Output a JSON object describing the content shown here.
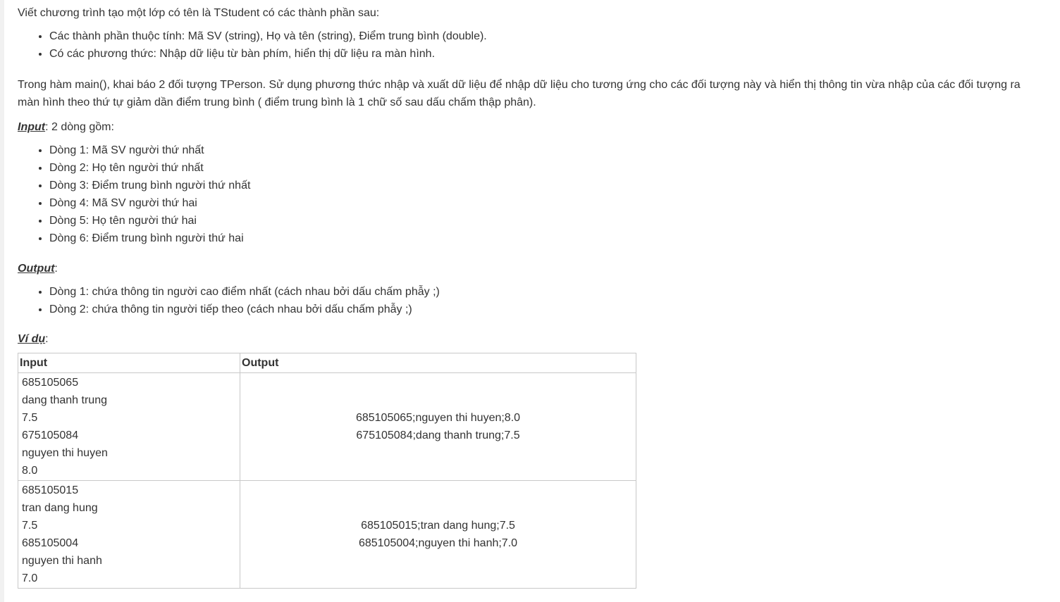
{
  "problem": {
    "intro": "Viết chương trình tạo một lớp có tên là TStudent có các thành phần sau:",
    "properties": [
      "Các thành phần thuộc tính: Mã SV (string), Họ và tên (string), Điểm trung bình (double).",
      "Có các phương thức: Nhập dữ liệu từ bàn phím, hiển thị dữ liệu ra màn hình."
    ],
    "main_paragraph": "Trong hàm main(), khai báo 2 đối tượng TPerson. Sử dụng phương thức nhập và xuất dữ liệu để nhập dữ liệu cho tương ứng cho các đối tượng này và hiển thị thông tin vừa nhập của các đối tượng ra màn hình theo thứ tự giảm dần điểm trung bình ( điểm trung bình là 1 chữ số sau dấu chấm thập phân).",
    "input_label": "Input",
    "input_suffix": ": 2 dòng gồm:",
    "input_lines": [
      "Dòng 1: Mã SV người thứ nhất",
      "Dòng 2: Họ tên người thứ nhất",
      "Dòng 3: Điểm trung bình người thứ nhất",
      "Dòng 4: Mã SV người thứ hai",
      "Dòng 5: Họ tên người thứ hai",
      "Dòng 6: Điểm trung bình người thứ hai"
    ],
    "output_label": "Output",
    "output_suffix": ":",
    "output_lines": [
      "Dòng 1: chứa thông tin người cao điểm nhất (cách nhau bởi dấu chấm phẫy ;)",
      "Dòng 2: chứa thông tin người tiếp theo (cách nhau bởi dấu chấm phẫy ;)"
    ],
    "example_label": "Ví dụ",
    "example_suffix": ":"
  },
  "table": {
    "headers": [
      "Input",
      "Output"
    ],
    "rows": [
      {
        "input": [
          "685105065",
          "dang thanh trung",
          "7.5",
          "675105084",
          "nguyen thi huyen",
          "8.0"
        ],
        "output": [
          "685105065;nguyen thi huyen;8.0",
          "675105084;dang thanh trung;7.5"
        ]
      },
      {
        "input": [
          "685105015",
          "tran dang hung",
          "7.5",
          "685105004",
          "nguyen thi hanh",
          "7.0"
        ],
        "output": [
          "685105015;tran dang hung;7.5",
          "685105004;nguyen thi hanh;7.0"
        ]
      }
    ]
  }
}
